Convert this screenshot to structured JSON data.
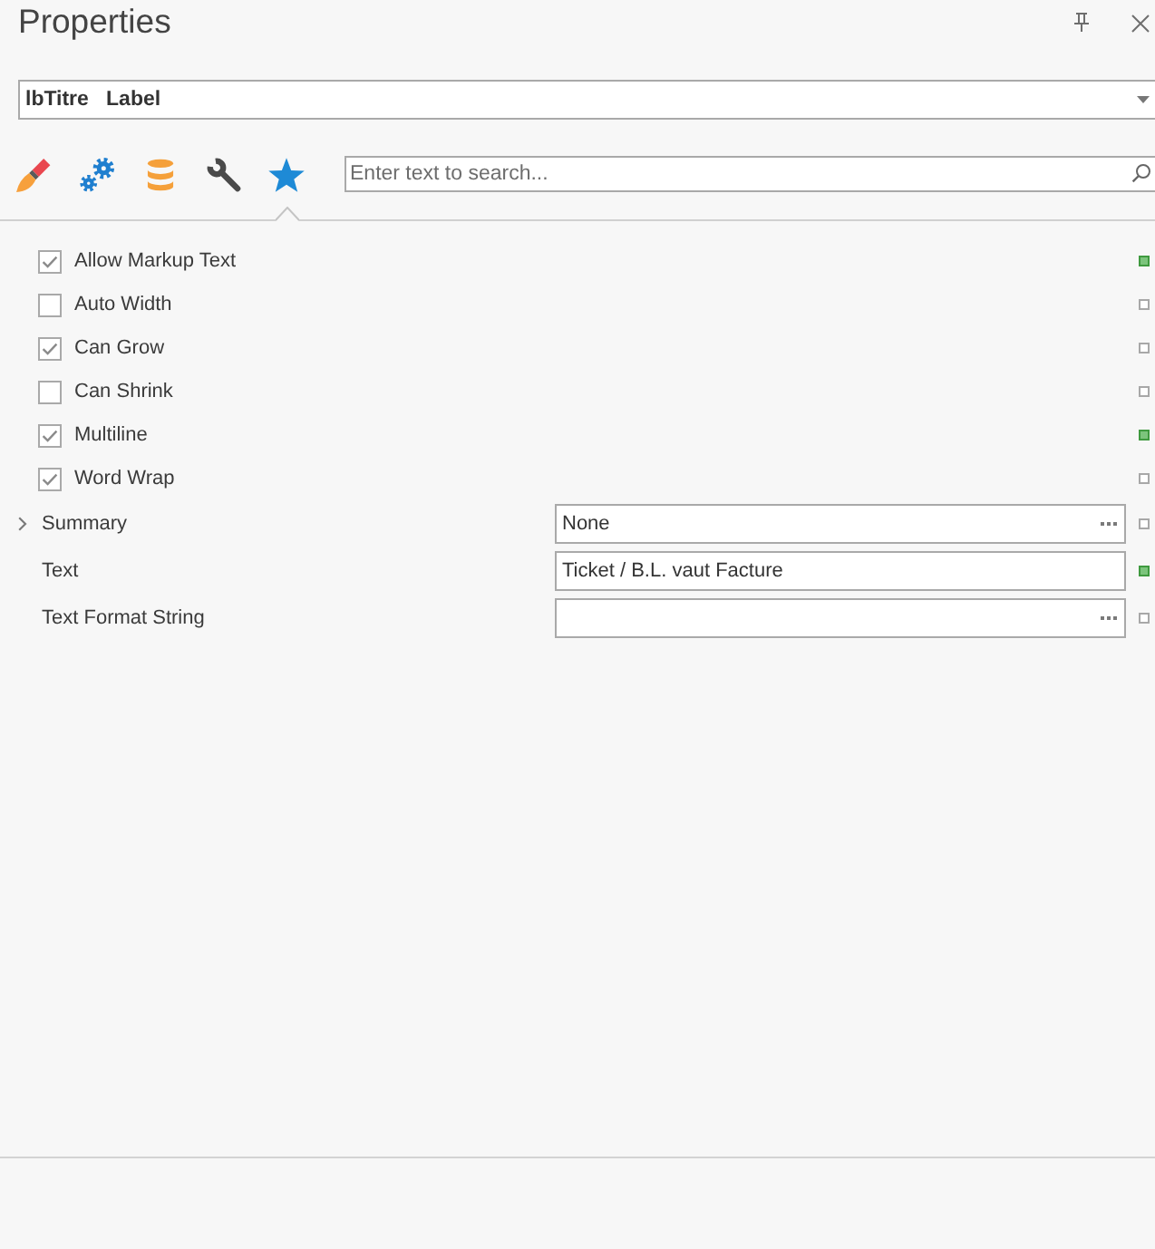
{
  "panel": {
    "title": "Properties"
  },
  "object_selector": {
    "value": "lbTitre   Label"
  },
  "tabs": [
    {
      "selected": false
    },
    {
      "selected": false
    },
    {
      "selected": false
    },
    {
      "selected": false
    },
    {
      "selected": true
    }
  ],
  "search": {
    "placeholder": "Enter text to search..."
  },
  "properties": [
    {
      "kind": "checkbox",
      "label": "Allow Markup Text",
      "checked": true,
      "modified": true
    },
    {
      "kind": "checkbox",
      "label": "Auto Width",
      "checked": false,
      "modified": false
    },
    {
      "kind": "checkbox",
      "label": "Can Grow",
      "checked": true,
      "modified": false
    },
    {
      "kind": "checkbox",
      "label": "Can Shrink",
      "checked": false,
      "modified": false
    },
    {
      "kind": "checkbox",
      "label": "Multiline",
      "checked": true,
      "modified": true
    },
    {
      "kind": "checkbox",
      "label": "Word Wrap",
      "checked": true,
      "modified": false
    },
    {
      "kind": "editor",
      "label": "Summary",
      "value": "None",
      "expandable": true,
      "ellipsis_button": true,
      "modified": false
    },
    {
      "kind": "editor",
      "label": "Text",
      "value": "Ticket / B.L. vaut Facture",
      "expandable": false,
      "ellipsis_button": false,
      "modified": true
    },
    {
      "kind": "editor",
      "label": "Text Format String",
      "expandable": false,
      "ellipsis_button": true,
      "modified": false
    }
  ]
}
